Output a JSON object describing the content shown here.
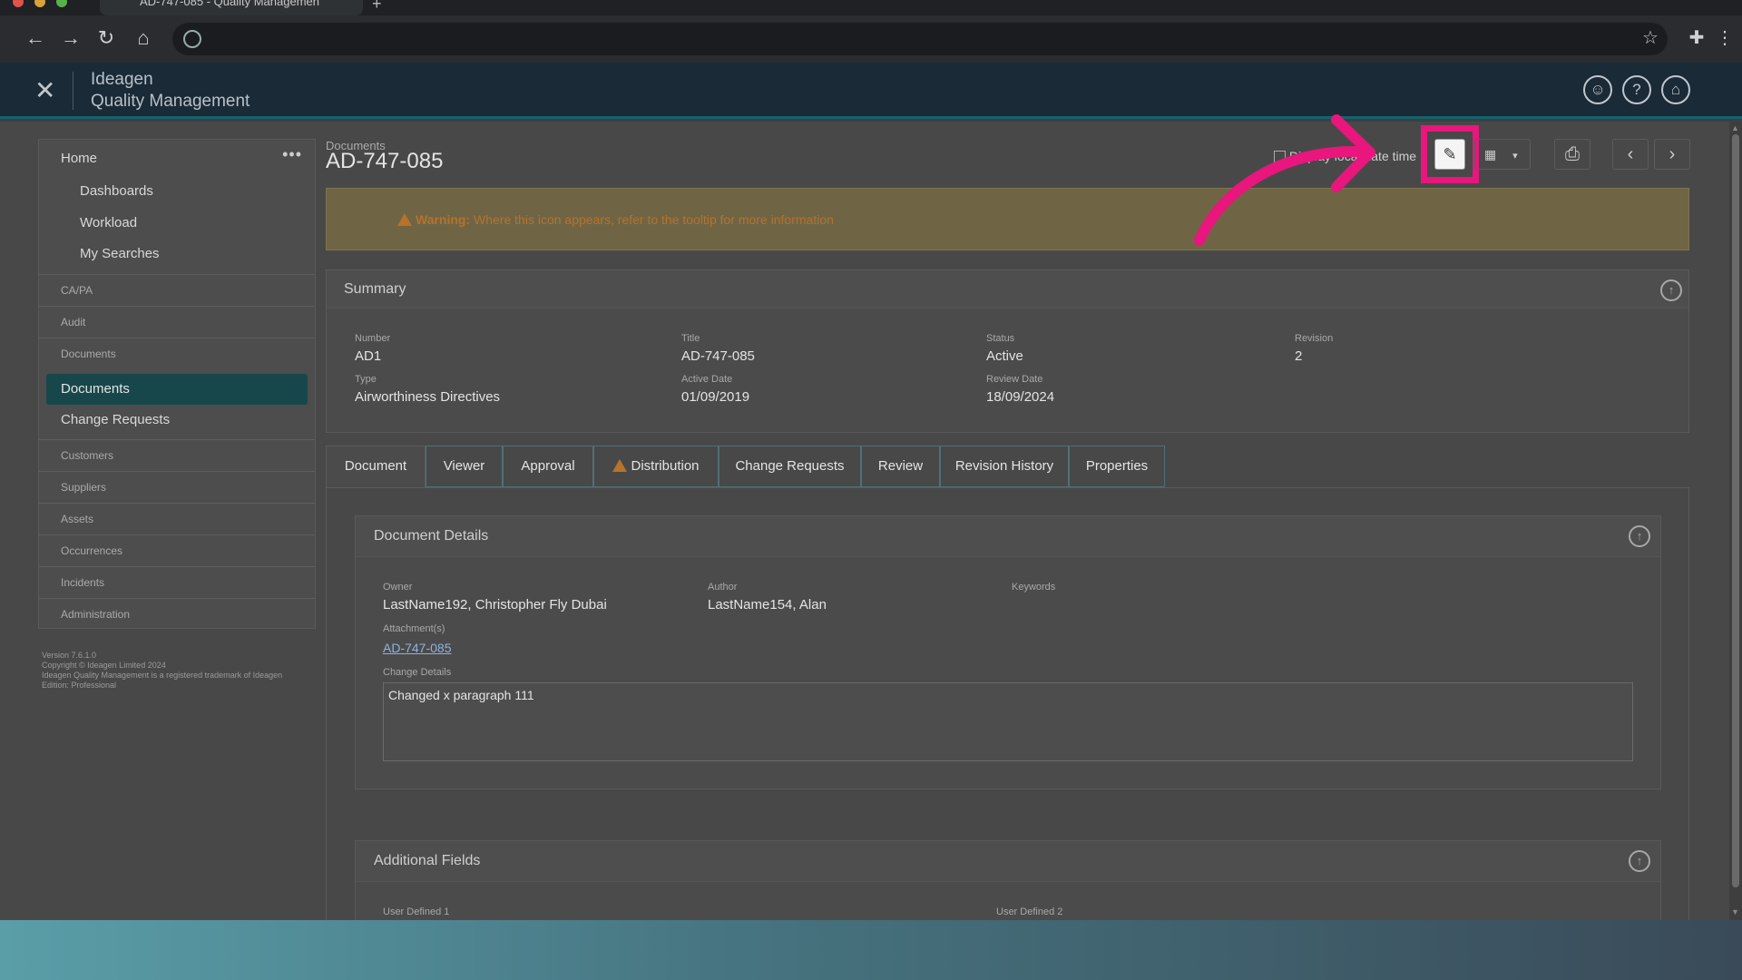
{
  "browser": {
    "tab_title": "AD-747-085 - Quality Managemen",
    "new_tab": "+",
    "back_icon": "arrow-left-icon",
    "forward_icon": "arrow-right-icon"
  },
  "app": {
    "brand_top": "Ideagen",
    "brand_bottom": "Quality Management",
    "close_glyph": "✕"
  },
  "sidebar": {
    "home": "Home",
    "dots": "•••",
    "sub_items": [
      "Dashboards",
      "Workload",
      "My Searches"
    ],
    "sections": [
      "CA/PA",
      "Audit",
      "Documents"
    ],
    "active_item": "Documents",
    "change_requests": "Change Requests",
    "more_sections": [
      "Customers",
      "Suppliers",
      "Assets",
      "Occurrences",
      "Incidents",
      "Administration"
    ],
    "footer": {
      "version": "Version 7.6.1.0",
      "copyright": "Copyright © Ideagen Limited 2024",
      "trademark": "Ideagen Quality Management is a registered trademark of Ideagen",
      "edition": "Edition: Professional"
    }
  },
  "page": {
    "breadcrumb": "Documents",
    "title": "AD-747-085",
    "display_local": "Display local date time",
    "grid_caret": "▾"
  },
  "warning": {
    "label": "Warning:",
    "text": "Where this icon appears, refer to the tooltip for more information"
  },
  "summary": {
    "title": "Summary",
    "fields": [
      {
        "label": "Number",
        "value": "AD1"
      },
      {
        "label": "Title",
        "value": "AD-747-085"
      },
      {
        "label": "Status",
        "value": "Active"
      },
      {
        "label": "Revision",
        "value": "2"
      },
      {
        "label": "Type",
        "value": "Airworthiness Directives"
      },
      {
        "label": "Active Date",
        "value": "01/09/2019"
      },
      {
        "label": "Review Date",
        "value": "18/09/2024"
      }
    ]
  },
  "tabs": [
    "Document",
    "Viewer",
    "Approval",
    "Distribution",
    "Change Requests",
    "Review",
    "Revision History",
    "Properties"
  ],
  "document_details": {
    "title": "Document Details",
    "owner_label": "Owner",
    "owner": "LastName192, Christopher Fly Dubai",
    "author_label": "Author",
    "author": "LastName154, Alan",
    "keywords_label": "Keywords",
    "attachments_label": "Attachment(s)",
    "attachment": "AD-747-085",
    "change_details_label": "Change Details",
    "change_details": "Changed x paragraph 111"
  },
  "additional_fields": {
    "title": "Additional Fields",
    "ud1": "User Defined 1",
    "ud2": "User Defined 2"
  },
  "annotation_color": "#e8167d"
}
